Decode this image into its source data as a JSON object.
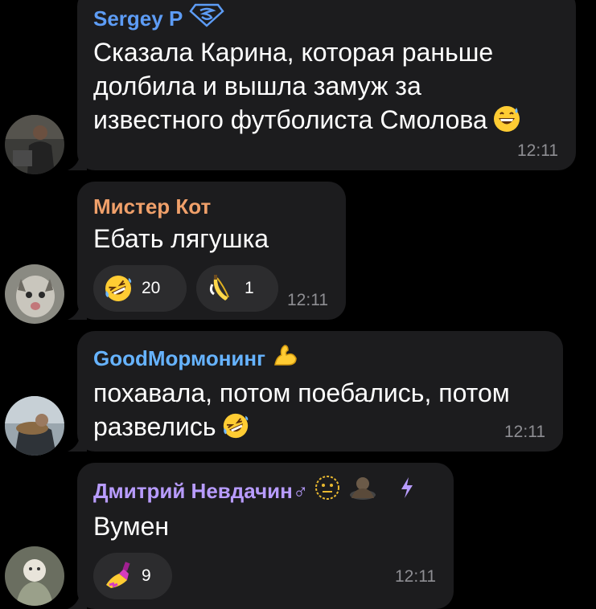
{
  "colors": {
    "background": "#000000",
    "bubble": "#1c1c1e",
    "reaction_bg": "#2c2c2e",
    "time_text": "#8e8e93",
    "sergey_name": "#5d9cf5",
    "mister_kot_name": "#f0a06a",
    "goodmormoning_name": "#66b3ff",
    "dmitriy_name": "#b89cff"
  },
  "messages": [
    {
      "sender": "Sergey P",
      "sender_badge_icon": "superman-shield-icon",
      "text_line1": "Сказала Карина, которая раньше",
      "text_line2": "долбила и вышла замуж за",
      "text_line3": "известного футболиста Смолова",
      "text_emoji_icon": "grinning-sweat-emoji-icon",
      "time": "12:11"
    },
    {
      "sender": "Мистер Кот",
      "text_line1": "Ебать лягушка",
      "time": "12:11",
      "reactions": [
        {
          "icon": "rofl-emoji-icon",
          "count": "20"
        },
        {
          "icon": "banana-emoji-icon",
          "count": "1"
        }
      ]
    },
    {
      "sender": "GoodМормонинг",
      "sender_badge_icon": "flexed-biceps-icon",
      "text_line1": "похавала, потом поебались, потом",
      "text_line2": "развелись",
      "text_emoji_icon": "rofl-emoji-icon",
      "time": "12:11"
    },
    {
      "sender": "Дмитрий Невдачин♂",
      "sender_badge_icon": "neutral-face-icon",
      "sender_badge2_icon": "custom-sticker-icon",
      "sender_badge3_icon": "lightning-icon",
      "text_line1": "Вумен",
      "time": "12:11",
      "reactions": [
        {
          "icon": "nail-polish-emoji-icon",
          "count": "9"
        }
      ]
    }
  ]
}
